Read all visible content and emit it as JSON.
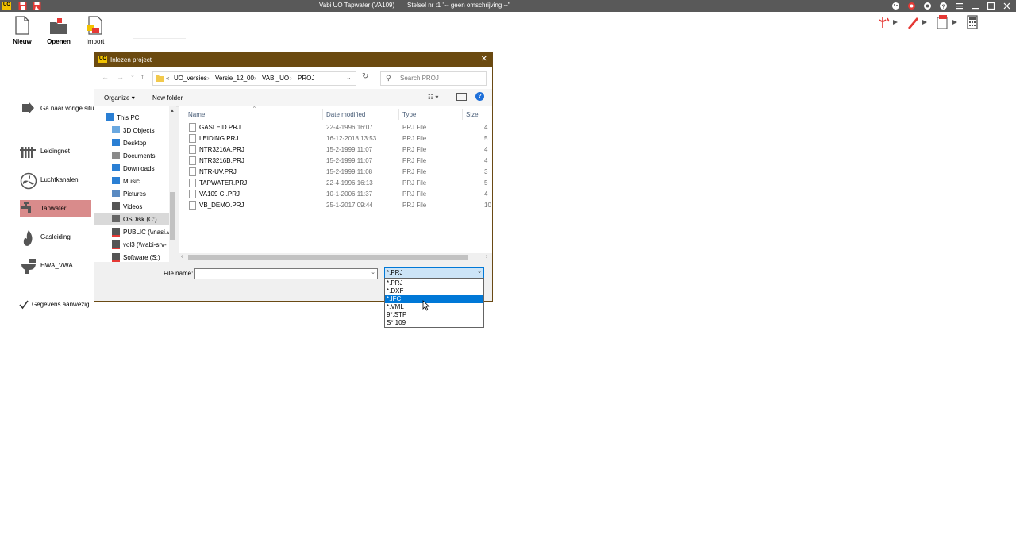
{
  "app": {
    "title": "Vabi UO Tapwater (VA109)",
    "stelsel": "Stelsel nr   :1  \"-- geen omschrijving --\"",
    "logo": "UO"
  },
  "ribbon": {
    "items": [
      {
        "label": "Nieuw",
        "icon": "new-document-icon"
      },
      {
        "label": "Openen",
        "icon": "open-folder-icon"
      },
      {
        "label": "Import",
        "icon": "import-icon"
      }
    ]
  },
  "nav": {
    "previous": "Ga naar vorige situa",
    "items": [
      {
        "label": "Leidingnet",
        "icon": "radiator-icon",
        "active": false
      },
      {
        "label": "Luchtkanalen",
        "icon": "fan-icon",
        "active": false
      },
      {
        "label": "Tapwater",
        "icon": "faucet-icon",
        "active": true
      },
      {
        "label": "Gasleiding",
        "icon": "flame-icon",
        "active": false
      },
      {
        "label": "HWA_VWA",
        "icon": "toilet-icon",
        "active": false
      }
    ],
    "check": "Gegevens aanwezig"
  },
  "dialog": {
    "title": "Inlezen project",
    "logo": "UO",
    "path": [
      "UO_versies",
      "Versie_12_00",
      "VABI_UO",
      "PROJ"
    ],
    "path_prefix": "«",
    "search_placeholder": "Search PROJ",
    "organize": "Organize",
    "new_folder": "New folder",
    "tree": [
      {
        "label": "This PC",
        "icon": "computer-icon",
        "indent": 0
      },
      {
        "label": "3D Objects",
        "icon": "cube-icon",
        "indent": 1
      },
      {
        "label": "Desktop",
        "icon": "desktop-icon",
        "indent": 1
      },
      {
        "label": "Documents",
        "icon": "documents-icon",
        "indent": 1
      },
      {
        "label": "Downloads",
        "icon": "downloads-icon",
        "indent": 1
      },
      {
        "label": "Music",
        "icon": "music-icon",
        "indent": 1
      },
      {
        "label": "Pictures",
        "icon": "pictures-icon",
        "indent": 1
      },
      {
        "label": "Videos",
        "icon": "videos-icon",
        "indent": 1
      },
      {
        "label": "OSDisk (C:)",
        "icon": "disk-icon",
        "indent": 1
      },
      {
        "label": "PUBLIC (\\\\nasi.v",
        "icon": "network-drive-icon",
        "indent": 1
      },
      {
        "label": "vol3 (\\\\vabi-srv-",
        "icon": "network-drive-icon",
        "indent": 1
      },
      {
        "label": "Software (S:)",
        "icon": "network-drive-icon",
        "indent": 1
      }
    ],
    "columns": [
      "Name",
      "Date modified",
      "Type",
      "Size"
    ],
    "files": [
      {
        "name": "GASLEID.PRJ",
        "date": "22-4-1996 16:07",
        "type": "PRJ File",
        "size": "4"
      },
      {
        "name": "LEIDING.PRJ",
        "date": "16-12-2018 13:53",
        "type": "PRJ File",
        "size": "5"
      },
      {
        "name": "NTR3216A.PRJ",
        "date": "15-2-1999 11:07",
        "type": "PRJ File",
        "size": "4"
      },
      {
        "name": "NTR3216B.PRJ",
        "date": "15-2-1999 11:07",
        "type": "PRJ File",
        "size": "4"
      },
      {
        "name": "NTR-UV.PRJ",
        "date": "15-2-1999 11:08",
        "type": "PRJ File",
        "size": "3"
      },
      {
        "name": "TAPWATER.PRJ",
        "date": "22-4-1996 16:13",
        "type": "PRJ File",
        "size": "5"
      },
      {
        "name": "VA109 CI.PRJ",
        "date": "10-1-2006 11:37",
        "type": "PRJ File",
        "size": "4"
      },
      {
        "name": "VB_DEMO.PRJ",
        "date": "25-1-2017 09:44",
        "type": "PRJ File",
        "size": "10"
      }
    ],
    "filename_label": "File name:",
    "filename_value": "",
    "filetype_selected": "*.PRJ",
    "filetype_options": [
      "*.PRJ",
      "*.DXF",
      "*.IFC",
      "*.VML",
      "9*.STP",
      "S*.109"
    ],
    "filetype_highlighted": 2
  },
  "colors": {
    "titlebar": "#595959",
    "dialog_title": "#6b4a10",
    "active_nav": "#d98b8b",
    "selection": "#0078d7"
  }
}
